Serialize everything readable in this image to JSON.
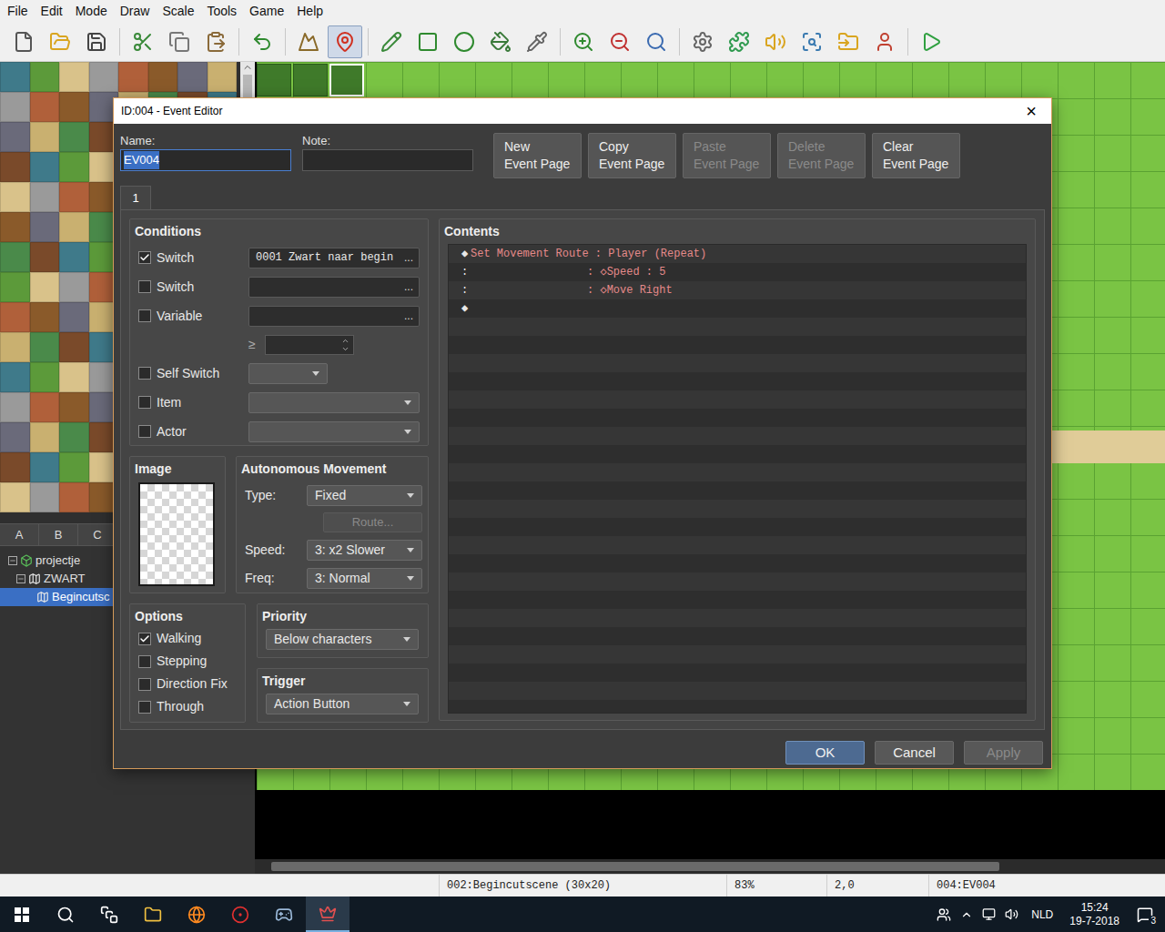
{
  "menu": [
    "File",
    "Edit",
    "Mode",
    "Draw",
    "Scale",
    "Tools",
    "Game",
    "Help"
  ],
  "toolbar": [
    {
      "kind": "new",
      "selected": false
    },
    {
      "kind": "open",
      "selected": false
    },
    {
      "kind": "save",
      "selected": false
    },
    {
      "kind": "cut",
      "selected": false
    },
    {
      "kind": "copy",
      "selected": false
    },
    {
      "kind": "paste",
      "selected": false
    },
    {
      "kind": "undo",
      "selected": false
    },
    {
      "kind": "map",
      "selected": false
    },
    {
      "kind": "event",
      "selected": true
    },
    {
      "kind": "pencil",
      "selected": false
    },
    {
      "kind": "rect",
      "selected": false
    },
    {
      "kind": "ellipse",
      "selected": false
    },
    {
      "kind": "fill",
      "selected": false
    },
    {
      "kind": "shadow",
      "selected": false
    },
    {
      "kind": "zoomin",
      "selected": false
    },
    {
      "kind": "zoomout",
      "selected": false
    },
    {
      "kind": "zoom11",
      "selected": false
    },
    {
      "kind": "settings",
      "selected": false
    },
    {
      "kind": "plugins",
      "selected": false
    },
    {
      "kind": "sound",
      "selected": false
    },
    {
      "kind": "search",
      "selected": false
    },
    {
      "kind": "resources",
      "selected": false
    },
    {
      "kind": "character",
      "selected": false
    },
    {
      "kind": "play",
      "selected": false
    }
  ],
  "tileset": {
    "tabs": [
      {
        "label": "A",
        "selected": false
      },
      {
        "label": "B",
        "selected": false
      },
      {
        "label": "C",
        "selected": false
      }
    ]
  },
  "map_tree": [
    {
      "label": "projectje",
      "kind": "project",
      "depth": 0,
      "expanded": true,
      "leaf": false,
      "selected": false
    },
    {
      "label": "ZWART",
      "kind": "map",
      "depth": 1,
      "expanded": true,
      "leaf": false,
      "selected": false
    },
    {
      "label": "Begincutsc",
      "kind": "map",
      "depth": 2,
      "expanded": false,
      "leaf": true,
      "selected": true
    }
  ],
  "status_bar": [
    "002:Begincutscene (30x20)",
    "83%",
    "2,0",
    "004:EV004"
  ],
  "taskbar": {
    "apps": [
      {
        "kind": "start",
        "selected": false
      },
      {
        "kind": "search",
        "selected": false
      },
      {
        "kind": "taskview",
        "selected": false
      },
      {
        "kind": "explorer",
        "selected": false
      },
      {
        "kind": "firefox",
        "selected": false
      },
      {
        "kind": "app",
        "selected": false
      },
      {
        "kind": "steam",
        "selected": false
      },
      {
        "kind": "rpgmaker",
        "selected": true
      }
    ],
    "language": "NLD",
    "time": "15:24",
    "date": "19-7-2018",
    "notifications": "3"
  },
  "dialog": {
    "title": "ID:004 - Event Editor",
    "close": "×",
    "name": {
      "label": "Name:",
      "value": "EV004",
      "focused": true
    },
    "note": {
      "label": "Note:",
      "value": ""
    },
    "page_buttons": [
      {
        "lines": [
          "New",
          "Event Page"
        ],
        "disabled": false
      },
      {
        "lines": [
          "Copy",
          "Event Page"
        ],
        "disabled": false
      },
      {
        "lines": [
          "Paste",
          "Event Page"
        ],
        "disabled": true
      },
      {
        "lines": [
          "Delete",
          "Event Page"
        ],
        "disabled": true
      },
      {
        "lines": [
          "Clear",
          "Event Page"
        ],
        "disabled": false
      }
    ],
    "page_tabs": [
      {
        "label": "1",
        "selected": true
      }
    ],
    "conditions": {
      "title": "Conditions",
      "rows": [
        {
          "kind": "picker",
          "label": "Switch",
          "checked": true,
          "value": "0001 Zwart naar begin",
          "button": "..."
        },
        {
          "kind": "picker",
          "label": "Switch",
          "checked": false,
          "value": "",
          "button": "..."
        },
        {
          "kind": "picker",
          "label": "Variable",
          "checked": false,
          "value": "",
          "button": "..."
        },
        {
          "kind": "compare",
          "label": "≥",
          "checked": false,
          "value": "",
          "button": ""
        },
        {
          "kind": "dropdown-short",
          "label": "Self Switch",
          "checked": false,
          "value": "",
          "button": ""
        },
        {
          "kind": "dropdown",
          "label": "Item",
          "checked": false,
          "value": "",
          "button": ""
        },
        {
          "kind": "dropdown",
          "label": "Actor",
          "checked": false,
          "value": "",
          "button": ""
        }
      ]
    },
    "image": {
      "title": "Image"
    },
    "movement": {
      "title": "Autonomous Movement",
      "type": {
        "label": "Type:",
        "value": "Fixed"
      },
      "route": {
        "label": "Route...",
        "disabled": true
      },
      "speed": {
        "label": "Speed:",
        "value": "3: x2 Slower"
      },
      "freq": {
        "label": "Freq:",
        "value": "3: Normal"
      }
    },
    "options": {
      "title": "Options",
      "items": [
        {
          "label": "Walking",
          "checked": true
        },
        {
          "label": "Stepping",
          "checked": false
        },
        {
          "label": "Direction Fix",
          "checked": false
        },
        {
          "label": "Through",
          "checked": false
        }
      ]
    },
    "priority": {
      "title": "Priority",
      "value": "Below characters"
    },
    "trigger": {
      "title": "Trigger",
      "value": "Action Button"
    },
    "contents": {
      "title": "Contents",
      "lines": [
        {
          "lead": "◆",
          "text": "Set Movement Route : Player (Repeat)",
          "continuation": false,
          "color": "#e58a8a"
        },
        {
          "lead": ":",
          "text": ": ◇Speed : 5",
          "continuation": true,
          "color": "#e58a8a"
        },
        {
          "lead": ":",
          "text": ": ◇Move Right",
          "continuation": true,
          "color": "#e58a8a"
        },
        {
          "lead": "◆",
          "text": "",
          "continuation": false,
          "color": "#e0e0e0"
        }
      ]
    },
    "buttons": [
      {
        "label": "OK",
        "default": true,
        "disabled": false
      },
      {
        "label": "Cancel",
        "default": false,
        "disabled": false
      },
      {
        "label": "Apply",
        "default": false,
        "disabled": true
      }
    ]
  }
}
